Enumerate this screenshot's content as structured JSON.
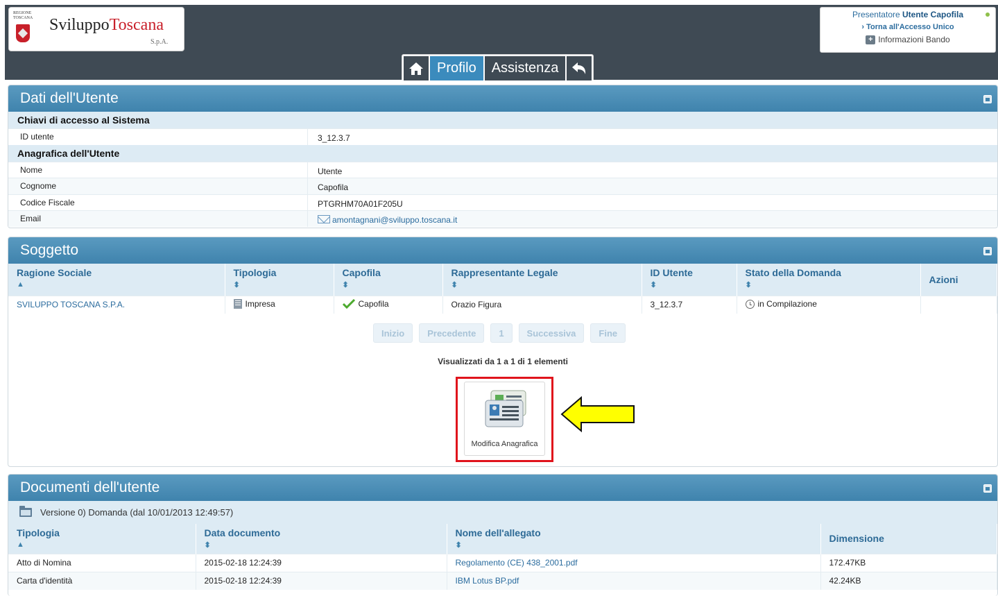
{
  "header": {
    "logo": {
      "region_line1": "REGIONE",
      "region_line2": "TOSCANA",
      "name_part1": "Sviluppo",
      "name_part2": "Toscana",
      "suffix": "S.p.A."
    },
    "nav": {
      "home_icon": "home-icon",
      "profilo": "Profilo",
      "assistenza": "Assistenza",
      "back_icon": "reply-arrow-icon"
    },
    "user_box": {
      "role_label": "Presentatore",
      "user_name": "Utente Capofila",
      "back_link": "› Torna all'Accesso Unico",
      "info_label": "Informazioni Bando"
    }
  },
  "dati_utente": {
    "title": "Dati dell'Utente",
    "section1": "Chiavi di accesso al Sistema",
    "id_label": "ID utente",
    "id_value": "3_12.3.7",
    "section2": "Anagrafica dell'Utente",
    "rows": [
      {
        "label": "Nome",
        "value": "Utente"
      },
      {
        "label": "Cognome",
        "value": "Capofila"
      },
      {
        "label": "Codice Fiscale",
        "value": "PTGRHM70A01F205U"
      },
      {
        "label": "Email",
        "value": "amontagnani@sviluppo.toscana.it"
      }
    ]
  },
  "soggetto": {
    "title": "Soggetto",
    "columns": [
      "Ragione Sociale",
      "Tipologia",
      "Capofila",
      "Rappresentante Legale",
      "ID Utente",
      "Stato della Domanda",
      "Azioni"
    ],
    "row": {
      "ragione_sociale": "SVILUPPO TOSCANA S.P.A.",
      "tipologia": "Impresa",
      "capofila": "Capofila",
      "rappresentante": "Orazio Figura",
      "id_utente": "3_12.3.7",
      "stato": "in Compilazione",
      "azioni": ""
    },
    "pager": {
      "first": "Inizio",
      "prev": "Precedente",
      "page": "1",
      "next": "Successiva",
      "last": "Fine",
      "info": "Visualizzati da 1 a 1 di 1 elementi"
    },
    "edit_button": "Modifica Anagrafica"
  },
  "documenti": {
    "title": "Documenti dell'utente",
    "version": "Versione 0) Domanda (dal 10/01/2013 12:49:57)",
    "columns": [
      "Tipologia",
      "Data documento",
      "Nome dell'allegato",
      "Dimensione"
    ],
    "rows": [
      {
        "tipologia": "Atto di Nomina",
        "data": "2015-02-18 12:24:39",
        "nome": "Regolamento (CE) 438_2001.pdf",
        "dim": "172.47KB"
      },
      {
        "tipologia": "Carta d'identità",
        "data": "2015-02-18 12:24:39",
        "nome": "IBM Lotus BP.pdf",
        "dim": "42.24KB"
      }
    ]
  },
  "colors": {
    "header_bg": "#3f4a54",
    "panel_head": "#4a8cb4",
    "active_tab": "#3b8bbd",
    "link": "#2b6c9e",
    "highlight_red": "#e0141c",
    "arrow_yellow": "#ffff00"
  }
}
